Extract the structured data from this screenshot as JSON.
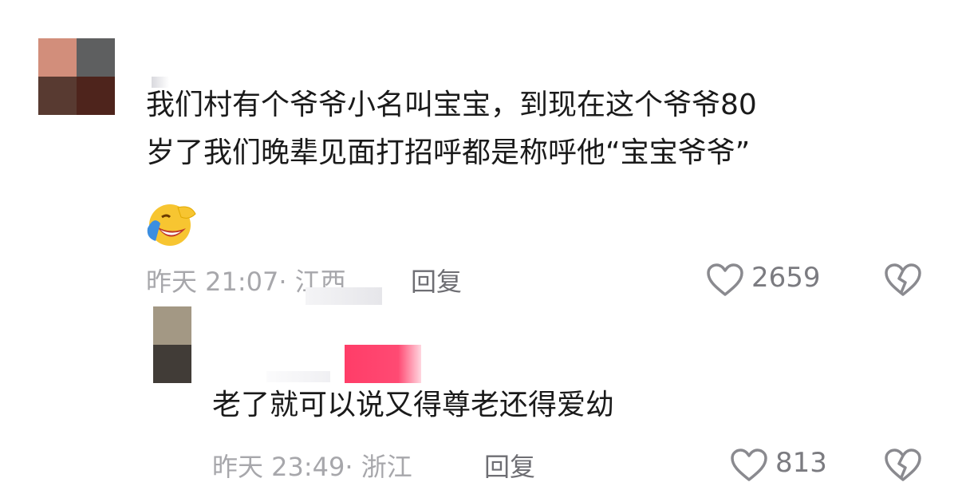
{
  "comments": [
    {
      "text_line1": "我们村有个爷爷小名叫宝宝，到现在这个爷爷80",
      "text_line2": "岁了我们晚辈见面打招呼都是称呼他“宝宝爷爷”",
      "time": "昨天 21:07",
      "location": "· 江西",
      "reply_label": "回复",
      "likes": "2659"
    },
    {
      "text": "老了就可以说又得尊老还得爱幼",
      "time": "昨天 23:49",
      "location": "· 浙江",
      "reply_label": "回复",
      "likes": "813"
    }
  ],
  "icons": [
    "heart-icon",
    "broken-heart-icon",
    "laughing-crying-emoji"
  ],
  "colors": {
    "avatar1": [
      "#d28e7b",
      "#5e5f60",
      "#583a31",
      "#4e241c"
    ],
    "avatar2": [
      "#a39884",
      "#413c37"
    ],
    "redacted_name": "#ff3d68"
  }
}
